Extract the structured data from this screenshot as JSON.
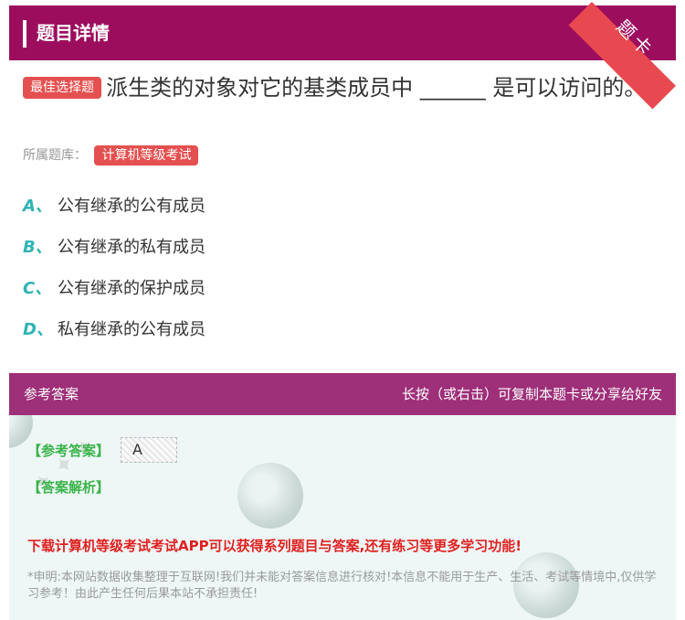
{
  "header": {
    "title": "题目详情",
    "ribbon_text": "题卡"
  },
  "question": {
    "type_tag": "最佳选择题",
    "text": "派生类的对象对它的基类成员中 ______ 是可以访问的。"
  },
  "bank": {
    "label": "所属题库：",
    "name": "计算机等级考试"
  },
  "options": [
    {
      "letter": "A、",
      "text": "公有继承的公有成员"
    },
    {
      "letter": "B、",
      "text": "公有继承的私有成员"
    },
    {
      "letter": "C、",
      "text": "公有继承的保护成员"
    },
    {
      "letter": "D、",
      "text": "私有继承的公有成员"
    }
  ],
  "answer_section": {
    "title": "参考答案",
    "share_hint": "长按（或右击）可复制本题卡或分享给好友",
    "answer_label": "【参考答案】",
    "answer_value": "A",
    "analysis_label": "【答案解析】",
    "promo": "下载计算机等级考试考试APP可以获得系列题目与答案,还有练习等更多学习功能!",
    "disclaimer": "*申明:本网站数据收集整理于互联网!我们并未能对答案信息进行核对!本信息不能用于生产、生活、考试等情境中,仅供学习参考！由此产生任何后果本站不承担责任!"
  },
  "colors": {
    "header_bg": "#9c0d5e",
    "answer_header_bg": "#9e2f79",
    "tag_red": "#e4504f",
    "option_letter": "#31b3b4",
    "answer_green": "#3ab34a",
    "promo_red": "#e02020"
  }
}
